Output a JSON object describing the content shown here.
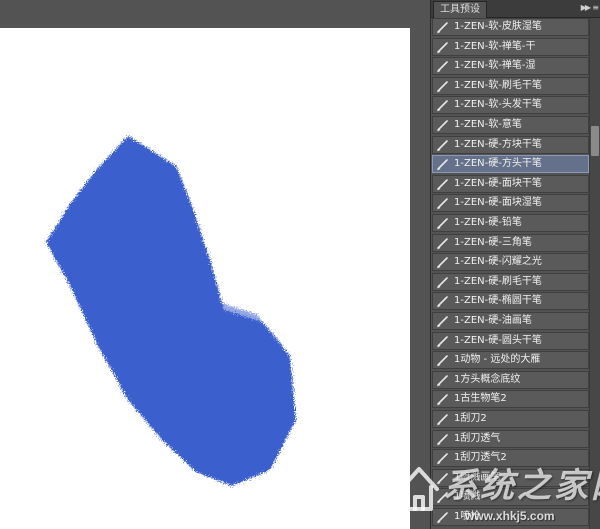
{
  "panel": {
    "title": "工具预设",
    "collapse_icon": "double-chevron-right-icon",
    "menu_icon": "panel-menu-icon"
  },
  "presets": [
    {
      "label": "1-ZEN-软-皮肤湿笔",
      "selected": false
    },
    {
      "label": "1-ZEN-软-禅笔-干",
      "selected": false
    },
    {
      "label": "1-ZEN-软-禅笔-湿",
      "selected": false
    },
    {
      "label": "1-ZEN-软-刷毛干笔",
      "selected": false
    },
    {
      "label": "1-ZEN-软-头发干笔",
      "selected": false
    },
    {
      "label": "1-ZEN-软-意笔",
      "selected": false
    },
    {
      "label": "1-ZEN-硬-方块干笔",
      "selected": false
    },
    {
      "label": "1-ZEN-硬-方头干笔",
      "selected": true
    },
    {
      "label": "1-ZEN-硬-面块干笔",
      "selected": false
    },
    {
      "label": "1-ZEN-硬-面块湿笔",
      "selected": false
    },
    {
      "label": "1-ZEN-硬-铅笔",
      "selected": false
    },
    {
      "label": "1-ZEN-硬-三角笔",
      "selected": false
    },
    {
      "label": "1-ZEN-硬-闪耀之光",
      "selected": false
    },
    {
      "label": "1-ZEN-硬-刷毛干笔",
      "selected": false
    },
    {
      "label": "1-ZEN-硬-椭圆干笔",
      "selected": false
    },
    {
      "label": "1-ZEN-硬-油画笔",
      "selected": false
    },
    {
      "label": "1-ZEN-硬-圆头干笔",
      "selected": false
    },
    {
      "label": "1动物 - 远处的大雁",
      "selected": false
    },
    {
      "label": "1方头概念底纹",
      "selected": false
    },
    {
      "label": "1古生物笔2",
      "selected": false
    },
    {
      "label": "1刮刀2",
      "selected": false
    },
    {
      "label": "1刮刀透气",
      "selected": false
    },
    {
      "label": "1刮刀透气2",
      "selected": false
    },
    {
      "label": "1喷溅画笔",
      "selected": false
    },
    {
      "label": "1喷溅",
      "selected": false
    },
    {
      "label": "1喷枪",
      "selected": false
    }
  ],
  "colors": {
    "stroke": "#3a5fcd",
    "selected_row": "#65718a",
    "panel_bg": "#535353"
  },
  "watermark": {
    "name": "系统之家网",
    "url": "www.xhkj5.com",
    "logo_icon": "house-logo-icon"
  }
}
